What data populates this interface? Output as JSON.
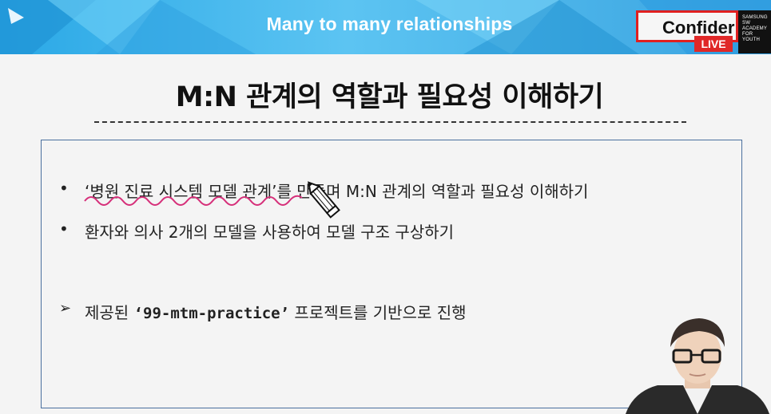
{
  "header": {
    "title": "Many to many relationships"
  },
  "badge": {
    "confidential": "Confider",
    "live": "LIVE"
  },
  "academy_logo": {
    "lines": [
      "SAMSUNG",
      "SW",
      "ACADEMY",
      "FOR",
      "YOUTH"
    ]
  },
  "slide": {
    "title": "M:N 관계의 역할과 필요성 이해하기",
    "bullets": [
      {
        "marker": "•",
        "text": "‘병원 진료 시스템 모델 관계’를 만들며 M:N 관계의 역할과 필요성 이해하기"
      },
      {
        "marker": "•",
        "text": "환자와 의사 2개의 모델을 사용하여 모델 구조 구상하기"
      }
    ],
    "note": {
      "marker": "➢",
      "prefix": "제공된 ",
      "code": "‘99-mtm-practice’",
      "suffix": " 프로젝트를 기반으로 진행"
    }
  },
  "colors": {
    "header_blue": "#2aa8e6",
    "confidential_border": "#e02020",
    "live_red": "#e02828",
    "annotation_pink": "#d6307a",
    "content_border": "#4a6f9e"
  },
  "icons": [
    "pencil-cursor-icon"
  ]
}
